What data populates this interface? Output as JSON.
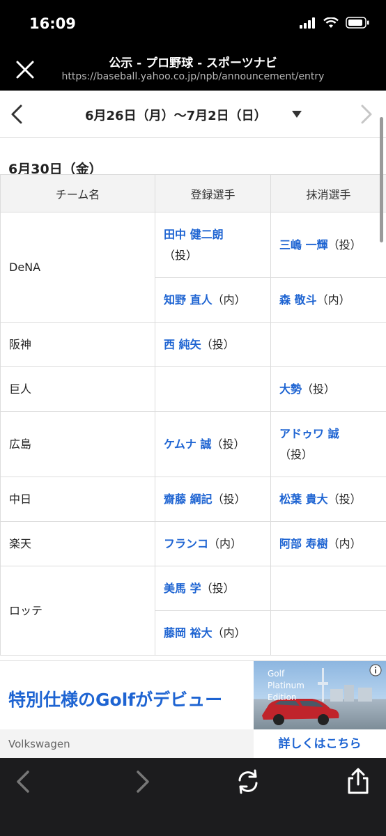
{
  "status": {
    "time": "16:09"
  },
  "browser": {
    "title": "公示 - プロ野球 - スポーツナビ",
    "url": "https://baseball.yahoo.co.jp/npb/announcement/entry"
  },
  "week": {
    "label": "6月26日（月）〜7月2日（日）"
  },
  "day": {
    "title": "6月30日（金）"
  },
  "table": {
    "headers": [
      "チーム名",
      "登録選手",
      "抹消選手"
    ],
    "rows": [
      {
        "team": "DeNA",
        "reg1_name": "田中 健二朗",
        "reg1_pos": "（投）",
        "del1_name": "三嶋 一輝",
        "del1_pos": "（投）",
        "reg2_name": "知野 直人",
        "reg2_pos": "（内）",
        "del2_name": "森 敬斗",
        "del2_pos": "（内）"
      },
      {
        "team": "阪神",
        "reg_name": "西 純矢",
        "reg_pos": "（投）"
      },
      {
        "team": "巨人",
        "del_name": "大勢",
        "del_pos": "（投）"
      },
      {
        "team": "広島",
        "reg_name": "ケムナ 誠",
        "reg_pos": "（投）",
        "del_name": "アドゥワ 誠",
        "del_pos": "（投）"
      },
      {
        "team": "中日",
        "reg_name": "齋藤 綱記",
        "reg_pos": "（投）",
        "del_name": "松葉 貴大",
        "del_pos": "（投）"
      },
      {
        "team": "楽天",
        "reg_name": "フランコ",
        "reg_pos": "（内）",
        "del_name": "阿部 寿樹",
        "del_pos": "（内）"
      },
      {
        "team": "ロッテ",
        "reg1_name": "美馬 学",
        "reg1_pos": "（投）",
        "reg2_name": "藤岡 裕大",
        "reg2_pos": "（内）"
      }
    ]
  },
  "ad": {
    "headline": "特別仕様のGolfがデビュー",
    "sponsor": "Volkswagen",
    "image_text_1": "Golf",
    "image_text_2": "Platinum",
    "image_text_3": "Edition",
    "cta": "詳しくはこちら"
  },
  "colors": {
    "link": "#1e64d2",
    "header_bg": "#f3f3f3",
    "toolbar_bg": "#1c1c1e"
  },
  "icons": [
    "close-icon",
    "chevron-left-icon",
    "chevron-right-icon",
    "dropdown-icon",
    "info-icon",
    "back-icon",
    "forward-icon",
    "reload-icon",
    "share-icon"
  ]
}
